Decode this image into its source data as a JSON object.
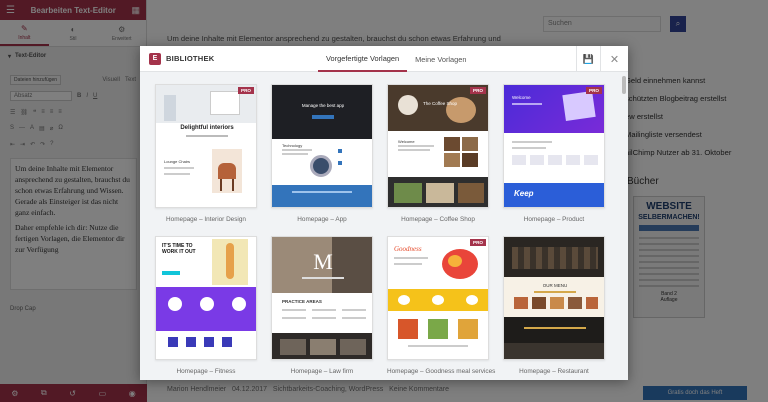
{
  "panel": {
    "title": "Bearbeiten Text-Editor",
    "tabs": [
      "Inhalt",
      "Stil",
      "Erweitert"
    ],
    "section": "Text-Editor",
    "add_media": "Dateien hinzufügen",
    "visual_tab": "Visuell",
    "text_tab": "Text",
    "format_select": "Absatz",
    "paragraphs": [
      "Um deine Inhalte mit Elementor ansprechend zu gestalten, brauchst du schon etwas Erfahrung und Wissen. Gerade als Einsteiger ist das nicht ganz einfach.",
      "Daher empfehle ich dir: Nutze die fertigen Vorlagen, die Elementor dir zur Verfügung"
    ],
    "dropcap_label": "Drop Cap"
  },
  "site": {
    "intro": "Um deine Inhalte mit Elementor ansprechend zu gestalten, brauchst du schon etwas Erfahrung und",
    "search_placeholder": "Suchen",
    "sidebar_links": [
      "Geld einnehmen kannst",
      "schützten Blogbeitrag erstellst",
      "ew erstellst",
      "Mailingliste versendest",
      "ailChimp Nutzer ab 31. Oktober"
    ],
    "books_heading": "Bücher",
    "book": {
      "title_line1": "WEBSITE",
      "title_line2": "SELBERMACHEN!",
      "band": "Band 2",
      "edition": "Auflage"
    },
    "meta": {
      "author": "Marion Hendlmeier",
      "date": "04.12.2017",
      "categories": "Sichtbarkeits-Coaching, WordPress",
      "comments": "Keine Kommentare"
    },
    "cta": "Gratis doch das Heft"
  },
  "modal": {
    "title": "BIBLIOTHEK",
    "tabs": [
      "Vorgefertigte Vorlagen",
      "Meine Vorlagen"
    ],
    "active_tab": "Vorgefertigte Vorlagen",
    "templates": [
      {
        "name": "Homepage – Interior Design",
        "pro": true,
        "headline": "Delightful interiors",
        "sub": "Lounge Chairs"
      },
      {
        "name": "Homepage – App",
        "pro": false,
        "headline": "Manage the best app",
        "sub": "Technology"
      },
      {
        "name": "Homepage – Coffee Shop",
        "pro": true,
        "headline": "The Coffee Shop",
        "sub": "Welcome"
      },
      {
        "name": "Homepage – Product",
        "pro": true,
        "headline": "Welcome",
        "sub": "Keep"
      },
      {
        "name": "Homepage – Fitness",
        "pro": false,
        "headline": "IT'S TIME TO WORK IT OUT",
        "sub": ""
      },
      {
        "name": "Homepage – Law firm",
        "pro": false,
        "headline": "M",
        "sub": "PRACTICE AREAS"
      },
      {
        "name": "Homepage – Goodness meal services",
        "pro": true,
        "headline": "Goodness",
        "sub": ""
      },
      {
        "name": "Homepage – Restaurant",
        "pro": false,
        "headline": "OUR MENU",
        "sub": ""
      }
    ],
    "pro_badge": "PRO"
  },
  "colors": {
    "brand": "#a4334b",
    "overlay": "rgba(0,0,0,0.5)",
    "search_button": "#334499"
  },
  "icons": [
    "hamburger-icon",
    "grid-icon",
    "pencil-icon",
    "contrast-icon",
    "gear-icon",
    "elementor-logo-icon",
    "save-icon",
    "close-icon",
    "search-icon"
  ]
}
